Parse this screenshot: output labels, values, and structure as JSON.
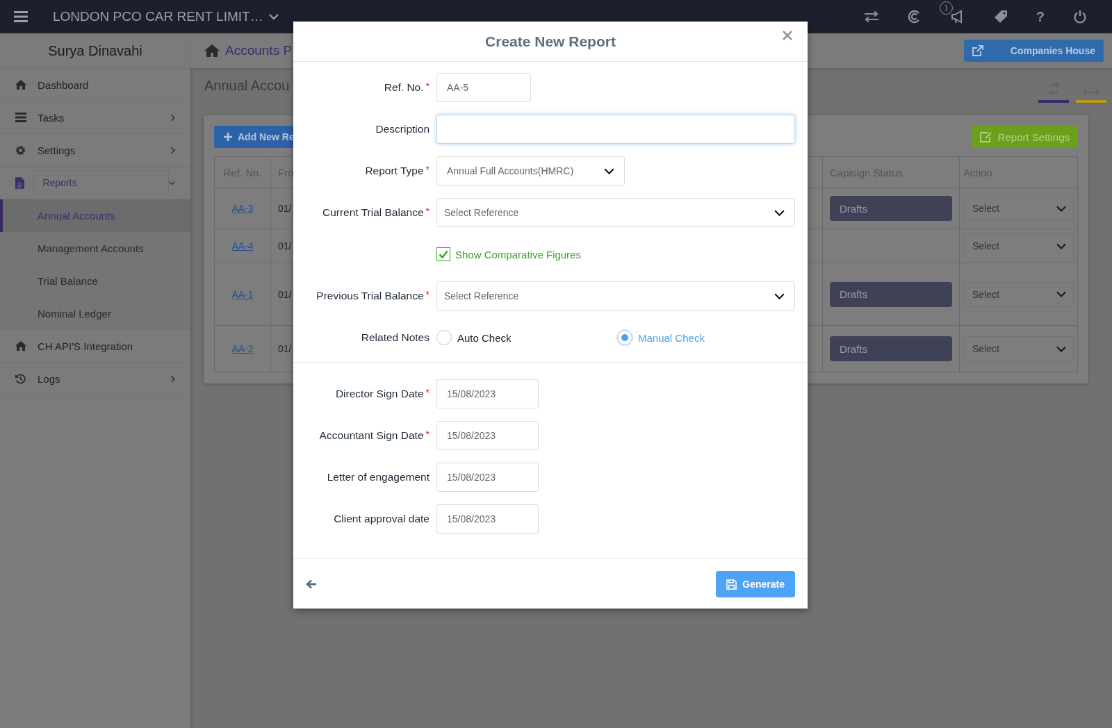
{
  "topbar": {
    "company": "LONDON PCO CAR RENT LIMIT…",
    "notification_count": "1",
    "help": "?"
  },
  "sidebar": {
    "user": "Surya Dinavahi",
    "items": [
      {
        "label": "Dashboard",
        "selected": false
      },
      {
        "label": "Tasks",
        "expanded": false,
        "selected": false
      },
      {
        "label": "Settings",
        "expanded": false,
        "selected": false
      },
      {
        "label": "Reports",
        "expanded": true,
        "selected": true,
        "children": [
          {
            "label": "Annual Accounts",
            "selected": true
          },
          {
            "label": "Management Accounts",
            "selected": false
          },
          {
            "label": "Trial Balance",
            "selected": false
          },
          {
            "label": "Nominal Ledger",
            "selected": false
          }
        ]
      },
      {
        "label": "CH API'S Integration",
        "selected": false
      },
      {
        "label": "Logs",
        "expanded": false,
        "selected": false
      }
    ]
  },
  "breadcrumb": "Accounts P",
  "companies_house_button": "Companies House",
  "page_title": "Annual Accou",
  "add_button": "Add New Re",
  "report_settings_button": "Report Settings",
  "table": {
    "columns": [
      "Ref. No.",
      "Fro",
      "Capisign Status",
      "Action"
    ],
    "rows": [
      {
        "ref": "AA-3",
        "from": "01/",
        "status": "Drafts",
        "action": "Select"
      },
      {
        "ref": "AA-4",
        "from": "01/",
        "action": "Select"
      },
      {
        "ref": "AA-1",
        "from": "01/",
        "status": "Drafts",
        "action": "Select"
      },
      {
        "ref": "AA-2",
        "from": "01/",
        "status": "Drafts",
        "action": "Select"
      }
    ]
  },
  "modal": {
    "title": "Create New Report",
    "sections": [
      [
        {
          "kind": "short_text",
          "label": "Ref. No.",
          "required_mark": "*",
          "value": "AA-5"
        },
        {
          "kind": "text",
          "label": "Description",
          "focused": true
        },
        {
          "kind": "dropdown",
          "label": "Report Type",
          "required_mark": "*",
          "value": "Annual Full Accounts(HMRC)"
        },
        {
          "kind": "select",
          "label": "Current Trial Balance",
          "required_mark": "*",
          "placeholder": "Select Reference"
        },
        {
          "kind": "checkbox",
          "label": "Show Comparative Figures",
          "checked": true
        },
        {
          "kind": "select",
          "label": "Previous Trial Balance",
          "required_mark": "*",
          "placeholder": "Select Reference"
        },
        {
          "kind": "radio",
          "label": "Related Notes",
          "options": [
            {
              "label": "Auto Check",
              "selected": false
            },
            {
              "label": "Manual Check",
              "selected": true
            }
          ]
        }
      ],
      [
        {
          "kind": "date",
          "label": "Director Sign Date",
          "required_mark": "*",
          "value": "15/08/2023"
        },
        {
          "kind": "date",
          "label": "Accountant Sign Date",
          "required_mark": "*",
          "value": "15/08/2023"
        },
        {
          "kind": "date",
          "label": "Letter of engagement",
          "value": "15/08/2023"
        },
        {
          "kind": "date",
          "label": "Client approval date",
          "value": "15/08/2023"
        }
      ]
    ],
    "generate_button": "Generate"
  }
}
